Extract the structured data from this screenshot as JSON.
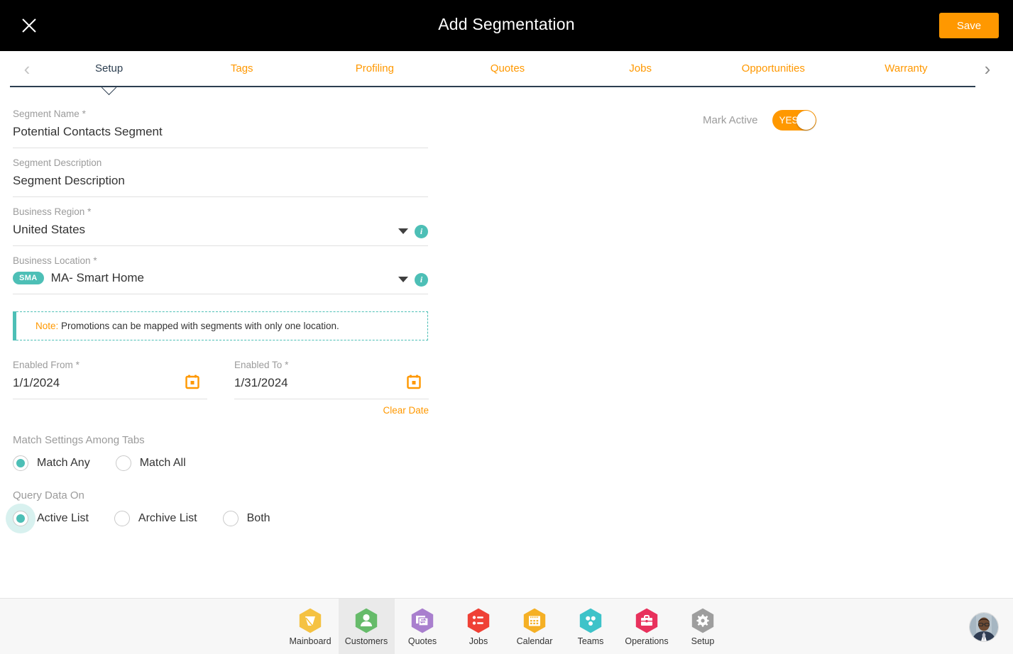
{
  "header": {
    "title": "Add Segmentation",
    "close_icon": "close-icon",
    "save_label": "Save"
  },
  "tabbar": {
    "prev_icon": "chevron-left-icon",
    "next_icon": "chevron-right-icon",
    "active_tab": "Setup",
    "tabs": [
      {
        "label": "Setup",
        "active": true
      },
      {
        "label": "Tags",
        "active": false
      },
      {
        "label": "Profiling",
        "active": false
      },
      {
        "label": "Quotes",
        "active": false
      },
      {
        "label": "Jobs",
        "active": false
      },
      {
        "label": "Opportunities",
        "active": false
      },
      {
        "label": "Warranty",
        "active": false
      }
    ]
  },
  "form": {
    "segment_name": {
      "label": "Segment Name",
      "required": "*",
      "value": "Potential Contacts Segment"
    },
    "segment_description": {
      "label": "Segment Description",
      "required": "",
      "value": "Segment Description"
    },
    "business_region": {
      "label": "Business Region",
      "required": "*",
      "value": "United States",
      "caret_icon": "chevron-down-icon",
      "info_icon": "info-icon",
      "info_glyph": "i"
    },
    "business_location": {
      "label": "Business Location",
      "required": "*",
      "badge": "SMA",
      "value": "MA- Smart Home",
      "caret_icon": "chevron-down-icon",
      "info_icon": "info-icon",
      "info_glyph": "i"
    },
    "note": {
      "keyword": "Note:",
      "text": " Promotions can be mapped with segments with only one location."
    },
    "enabled_from": {
      "label": "Enabled From",
      "required": "*",
      "value": "1/1/2024",
      "calendar_icon": "calendar-icon"
    },
    "enabled_to": {
      "label": "Enabled To",
      "required": "*",
      "value": "1/31/2024",
      "calendar_icon": "calendar-icon"
    },
    "clear_date_label": "Clear Date",
    "match_settings": {
      "label": "Match Settings Among Tabs",
      "options": [
        {
          "label": "Match Any",
          "checked": true,
          "halo": false
        },
        {
          "label": "Match All",
          "checked": false,
          "halo": false
        }
      ]
    },
    "query_data_on": {
      "label": "Query Data On",
      "options": [
        {
          "label": "Active List",
          "checked": true,
          "halo": true
        },
        {
          "label": "Archive List",
          "checked": false,
          "halo": false
        },
        {
          "label": "Both",
          "checked": false,
          "halo": false
        }
      ]
    }
  },
  "mark_active": {
    "label": "Mark Active",
    "toggle_value": "YES",
    "toggle_on": true
  },
  "bottom_nav": {
    "items": [
      {
        "label": "Mainboard",
        "icon": "mainboard-icon",
        "color": "#f5c242",
        "active": false
      },
      {
        "label": "Customers",
        "icon": "customers-icon",
        "color": "#66bb6a",
        "active": true
      },
      {
        "label": "Quotes",
        "icon": "quotes-icon",
        "color": "#a97fce",
        "active": false
      },
      {
        "label": "Jobs",
        "icon": "jobs-icon",
        "color": "#ef4136",
        "active": false
      },
      {
        "label": "Calendar",
        "icon": "calendar-icon",
        "color": "#f5b025",
        "active": false
      },
      {
        "label": "Teams",
        "icon": "teams-icon",
        "color": "#3ec3c9",
        "active": false
      },
      {
        "label": "Operations",
        "icon": "operations-icon",
        "color": "#e8315c",
        "active": false
      },
      {
        "label": "Setup",
        "icon": "setup-gear-icon",
        "color": "#9e9e9e",
        "active": false
      }
    ],
    "avatar": "user-avatar"
  },
  "colors": {
    "accent_orange": "#ff9800",
    "accent_teal": "#4dbfb6",
    "header_bg": "#000000",
    "tab_underline": "#2c3e50",
    "label_gray": "#9b9b9b"
  }
}
